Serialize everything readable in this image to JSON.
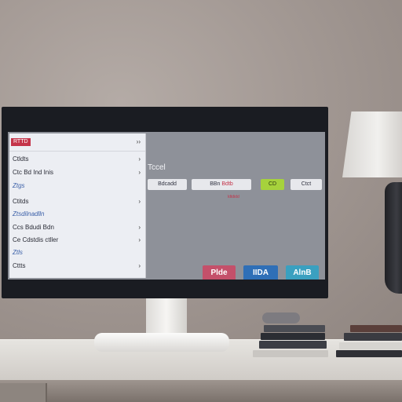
{
  "screen": {
    "sidebar": {
      "header_label": "RTTD",
      "rows": [
        {
          "label": "Ctldts",
          "chev": "›",
          "blue": false
        },
        {
          "label": "Ctc Bd Ind Inis",
          "chev": "›",
          "blue": false
        },
        {
          "label": "Ztgs",
          "chev": "",
          "blue": true
        },
        {
          "label": "Ctitds",
          "chev": "›",
          "blue": false
        },
        {
          "label": "Ztsdilnadlln",
          "chev": "",
          "blue": true
        },
        {
          "label": "Ccs Bdudi Bdn",
          "chev": "›",
          "blue": false
        },
        {
          "label": "Ce Cdstdis ctller",
          "chev": "›",
          "blue": false
        },
        {
          "label": "Ztls",
          "chev": "",
          "blue": true
        },
        {
          "label": "Cttts",
          "chev": "›",
          "blue": false
        }
      ],
      "top_right_mark": "››"
    },
    "title": "Tccel",
    "chips": [
      {
        "label": "Bdcadd",
        "kind": "plain"
      },
      {
        "label": "BBn",
        "accent": "Bdtb",
        "kind": "accent"
      },
      {
        "label": "CD",
        "kind": "green"
      },
      {
        "label": "Ctct",
        "kind": "plain"
      }
    ],
    "red_note": "ldtdidd",
    "tiles": [
      {
        "label": "Plde",
        "color": "#c4506a"
      },
      {
        "label": "IIDA",
        "color": "#2f6fb7"
      },
      {
        "label": "AlnB",
        "color": "#3aa0c0"
      }
    ]
  }
}
